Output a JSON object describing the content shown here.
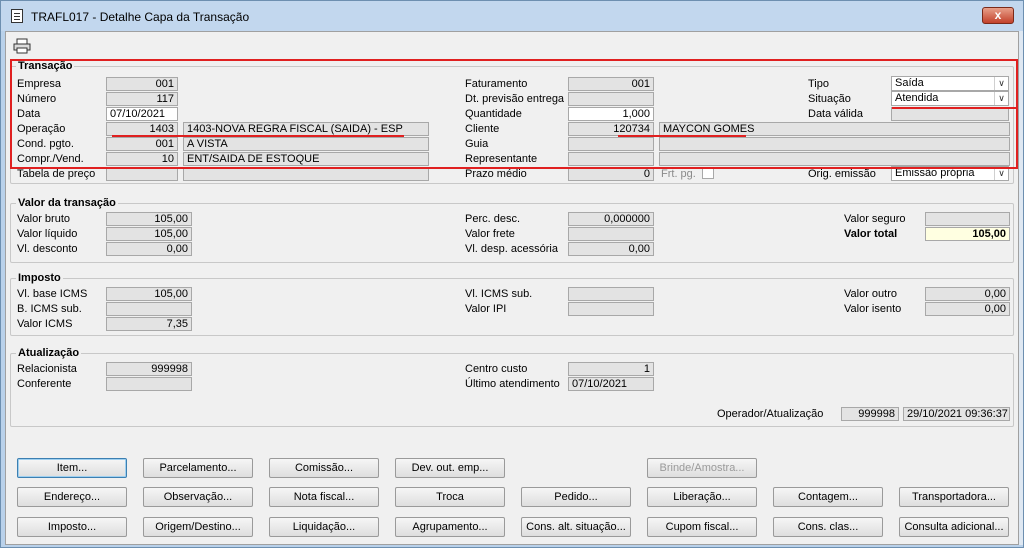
{
  "window": {
    "title": "TRAFL017 - Detalhe Capa da Transação",
    "close": "x"
  },
  "transacao": {
    "title": "Transação",
    "empresa": {
      "label": "Empresa",
      "value": "001"
    },
    "numero": {
      "label": "Número",
      "value": "117"
    },
    "data": {
      "label": "Data",
      "value": "07/10/2021"
    },
    "operacao": {
      "label": "Operação",
      "code": "1403",
      "desc": "1403-NOVA REGRA FISCAL (SAIDA) - ESP"
    },
    "cond_pgto": {
      "label": "Cond. pgto.",
      "code": "001",
      "desc": "A VISTA"
    },
    "compr_vend": {
      "label": "Compr./Vend.",
      "code": "10",
      "desc": "ENT/SAIDA DE ESTOQUE"
    },
    "tabela_preco": {
      "label": "Tabela de preço",
      "code": "",
      "desc": ""
    },
    "faturamento": {
      "label": "Faturamento",
      "value": "001"
    },
    "dt_previsao": {
      "label": "Dt. previsão entrega",
      "value": ""
    },
    "quantidade": {
      "label": "Quantidade",
      "value": "1,000"
    },
    "cliente": {
      "label": "Cliente",
      "code": "120734",
      "desc": "MAYCON GOMES"
    },
    "guia": {
      "label": "Guia",
      "code": "",
      "desc": ""
    },
    "representante": {
      "label": "Representante",
      "code": "",
      "desc": ""
    },
    "prazo_medio": {
      "label": "Prazo médio",
      "value": "0"
    },
    "frt_pg": {
      "label": "Frt. pg."
    },
    "tipo": {
      "label": "Tipo",
      "value": "Saída"
    },
    "situacao": {
      "label": "Situação",
      "value": "Atendida"
    },
    "data_valida": {
      "label": "Data válida",
      "value": ""
    },
    "orig_emissao": {
      "label": "Orig. emissão",
      "value": "Emissão própria"
    }
  },
  "valor": {
    "title": "Valor da transação",
    "valor_bruto": {
      "label": "Valor bruto",
      "value": "105,00"
    },
    "valor_liquido": {
      "label": "Valor líquido",
      "value": "105,00"
    },
    "vl_desconto": {
      "label": "Vl. desconto",
      "value": "0,00"
    },
    "perc_desc": {
      "label": "Perc. desc.",
      "value": "0,000000"
    },
    "valor_frete": {
      "label": "Valor frete",
      "value": ""
    },
    "vl_desp": {
      "label": "Vl. desp. acessória",
      "value": "0,00"
    },
    "valor_seguro": {
      "label": "Valor seguro",
      "value": ""
    },
    "valor_total": {
      "label": "Valor total",
      "value": "105,00"
    }
  },
  "imposto": {
    "title": "Imposto",
    "vl_base_icms": {
      "label": "Vl. base ICMS",
      "value": "105,00"
    },
    "b_icms_sub": {
      "label": "B. ICMS sub.",
      "value": ""
    },
    "valor_icms": {
      "label": "Valor ICMS",
      "value": "7,35"
    },
    "vl_icms_sub": {
      "label": "Vl. ICMS sub.",
      "value": ""
    },
    "valor_ipi": {
      "label": "Valor IPI",
      "value": ""
    },
    "valor_outro": {
      "label": "Valor outro",
      "value": "0,00"
    },
    "valor_isento": {
      "label": "Valor isento",
      "value": "0,00"
    }
  },
  "atualizacao": {
    "title": "Atualização",
    "relacionista": {
      "label": "Relacionista",
      "value": "999998"
    },
    "conferente": {
      "label": "Conferente",
      "value": ""
    },
    "centro_custo": {
      "label": "Centro custo",
      "value": "1"
    },
    "ultimo_atendimento": {
      "label": "Último atendimento",
      "value": "07/10/2021"
    },
    "operador": {
      "label": "Operador/Atualização",
      "code": "999998",
      "datetime": "29/10/2021 09:36:37"
    }
  },
  "buttons": {
    "row1": [
      "Item...",
      "Parcelamento...",
      "Comissão...",
      "Dev. out. emp...",
      "Brinde/Amostra..."
    ],
    "row2": [
      "Endereço...",
      "Observação...",
      "Nota fiscal...",
      "Troca",
      "Pedido...",
      "Liberação...",
      "Contagem...",
      "Transportadora..."
    ],
    "row3": [
      "Imposto...",
      "Origem/Destino...",
      "Liquidação...",
      "Agrupamento...",
      "Cons. alt. situação...",
      "Cupom fiscal...",
      "Cons. clas...",
      "Consulta adicional..."
    ]
  },
  "colors": {
    "highlight": "#e02020",
    "total_bg": "#ffffe1"
  }
}
